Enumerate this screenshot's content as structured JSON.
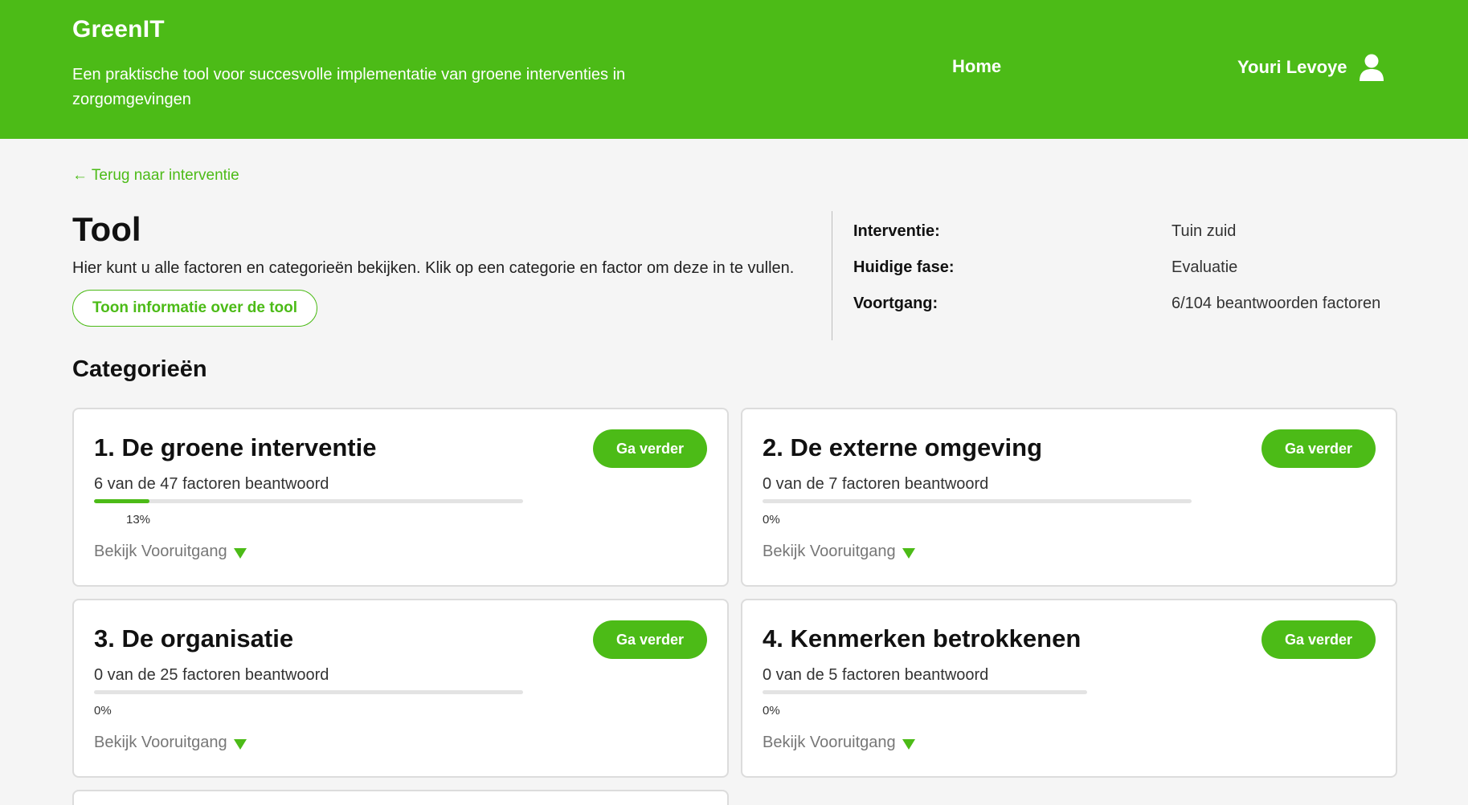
{
  "header": {
    "brand": "GreenIT",
    "tagline": "Een praktische tool voor succesvolle implementatie van groene interventies in zorgomgevingen",
    "nav_home": "Home",
    "user_name": "Youri Levoye",
    "user_icon": "user-icon",
    "background_color": "#4cbb17"
  },
  "back_link": "← Terug naar interventie",
  "page": {
    "title": "Tool",
    "intro": "Hier kunt u alle factoren en categorieën bekijken. Klik op een categorie en factor om deze in te vullen.",
    "info_button": "Toon informatie over de tool"
  },
  "meta": {
    "interventie_label": "Interventie:",
    "interventie_value": "Tuin zuid",
    "fase_label": "Huidige fase:",
    "fase_value": "Evaluatie",
    "voortgang_label": "Voortgang:",
    "voortgang_value": "6/104 beantwoorden factoren"
  },
  "section_title": "Categorieën",
  "categories": [
    {
      "title": "1. De groene interventie",
      "button": "Ga verder",
      "count_text": "6 van de 47 factoren beantwoord",
      "progress_fraction": 0.13,
      "percent_text": "13%",
      "link": "Bekijk Vooruitgang"
    },
    {
      "title": "2. De externe omgeving",
      "button": "Ga verder",
      "count_text": "0 van de 7 factoren beantwoord",
      "progress_fraction": 0,
      "percent_text": "0%",
      "link": "Bekijk Vooruitgang"
    },
    {
      "title": "3. De organisatie",
      "button": "Ga verder",
      "count_text": "0 van de 25 factoren beantwoord",
      "progress_fraction": 0,
      "percent_text": "0%",
      "link": "Bekijk Vooruitgang"
    },
    {
      "title": "4. Kenmerken betrokkenen",
      "button": "Ga verder",
      "count_text": "0 van de 5 factoren beantwoord",
      "progress_fraction": 0,
      "percent_text": "0%",
      "link": "Bekijk Vooruitgang"
    }
  ],
  "accent_color": "#4cbb17"
}
